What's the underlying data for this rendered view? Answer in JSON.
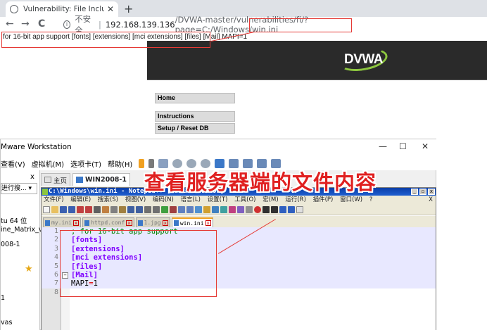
{
  "browser": {
    "tab_title": "Vulnerability: File Inclusion :: D",
    "tab_close": "✕",
    "new_tab": "+",
    "back": "←",
    "forward": "→",
    "reload": "C",
    "info": "i",
    "insecure_label": "不安全",
    "separator": "|",
    "url_host": "192.168.139.136",
    "url_rest": "/DVWA-master/vulnerabilities/fi/?page=C:/Windows/win.ini"
  },
  "page": {
    "raw_output": "for 16-bit app support [fonts] [extensions] [mci extensions] [files] [Mail] MAPI=1",
    "logo_text": "DVWA",
    "menu": [
      "Home",
      "Instructions",
      "Setup / Reset DB"
    ]
  },
  "vmware": {
    "title": "Mware Workstation",
    "minimize": "—",
    "maximize": "☐",
    "close": "✕",
    "menus": [
      "查看(V)",
      "虚拟机(M)",
      "选项卡(T)",
      "帮助(H)"
    ],
    "sidebar": {
      "close": "x",
      "search": "进行搜... ▾",
      "items": [
        "tu 64 位",
        "ine_Matrix_v",
        "008-1",
        "1",
        "vas"
      ]
    },
    "tabs": [
      "主页",
      "WIN2008-1"
    ]
  },
  "notepad": {
    "title": "C:\\Windows\\win.ini - Notepad++ [Administrator]",
    "title_buttons": [
      "_",
      "▫",
      "x"
    ],
    "menus": [
      "文件(F)",
      "编辑(E)",
      "搜索(S)",
      "视图(V)",
      "编码(N)",
      "语言(L)",
      "设置(T)",
      "工具(O)",
      "宏(M)",
      "运行(R)",
      "插件(P)",
      "窗口(W)",
      "?"
    ],
    "menu_close": "X",
    "tabs": [
      {
        "label": "my.ini",
        "active": false
      },
      {
        "label": "httpd.conf",
        "active": false
      },
      {
        "label": "1.jpg",
        "active": false
      },
      {
        "label": "win.ini",
        "active": true
      }
    ],
    "tab_close": "x",
    "lines": [
      {
        "num": "1",
        "fold": "",
        "parts": [
          {
            "cls": "c-comment",
            "text": "; for 16-bit app support"
          }
        ]
      },
      {
        "num": "2",
        "fold": "",
        "parts": [
          {
            "cls": "c-section",
            "text": "[fonts]"
          }
        ]
      },
      {
        "num": "3",
        "fold": "",
        "parts": [
          {
            "cls": "c-section",
            "text": "[extensions]"
          }
        ]
      },
      {
        "num": "4",
        "fold": "",
        "parts": [
          {
            "cls": "c-section",
            "text": "[mci extensions]"
          }
        ]
      },
      {
        "num": "5",
        "fold": "",
        "parts": [
          {
            "cls": "c-section",
            "text": "[files]"
          }
        ]
      },
      {
        "num": "6",
        "fold": "−",
        "parts": [
          {
            "cls": "c-section",
            "text": "[Mail]"
          }
        ]
      },
      {
        "num": "7",
        "fold": "",
        "parts": [
          {
            "cls": "c-key",
            "text": "MAPI"
          },
          {
            "cls": "c-eq",
            "text": "="
          },
          {
            "cls": "c-val",
            "text": "1"
          }
        ]
      },
      {
        "num": "8",
        "fold": "",
        "parts": []
      }
    ]
  },
  "annotation": "查看服务器端的文件内容",
  "colors": {
    "annotation_red": "#e02020",
    "dvwa_green": "#8dc63f",
    "npp_section": "#8000ff",
    "npp_comment": "#008000"
  }
}
